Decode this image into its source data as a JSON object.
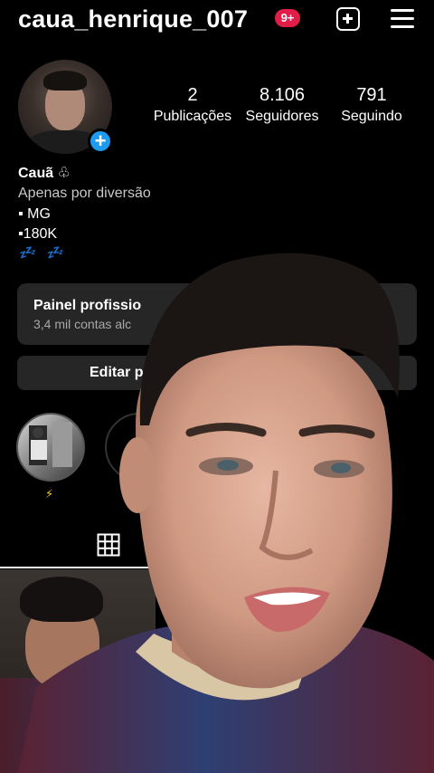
{
  "header": {
    "username": "caua_henrique_007",
    "notification_count": "9+",
    "icons": {
      "create": "plus-square-icon",
      "menu": "hamburger-menu-icon"
    }
  },
  "profile": {
    "stats": [
      {
        "value": "2",
        "label": "Publicações"
      },
      {
        "value": "8.106",
        "label": "Seguidores"
      },
      {
        "value": "791",
        "label": "Seguindo"
      }
    ],
    "name": "Cauã ♧",
    "bio": [
      "Apenas por diversão",
      "▪ MG",
      "▪180K",
      "💤 💤"
    ]
  },
  "panel": {
    "title": "Painel profissio",
    "subtitle": "3,4 mil contas alc"
  },
  "buttons": {
    "edit": "Editar per"
  },
  "highlights": [
    {
      "label": "⚡"
    }
  ],
  "tabs": {
    "grid_icon": "grid-icon"
  },
  "colors": {
    "badge": "#e11d48",
    "accent": "#1d9bf0",
    "surface": "#262626"
  }
}
